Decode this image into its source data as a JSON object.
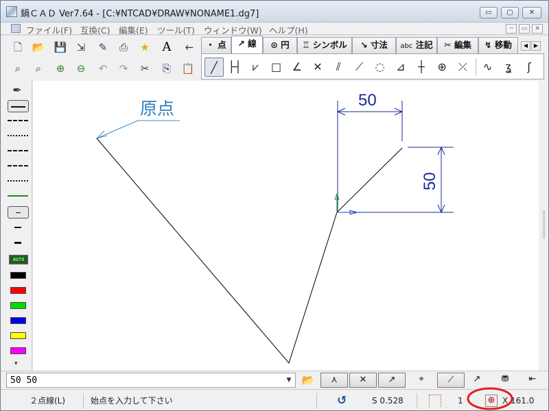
{
  "window": {
    "title": "鍋ＣＡＤ Ver7.64 - [C:¥NTCAD¥DRAW¥NONAME1.dg7]",
    "buttons": {
      "minimize": "▭",
      "maximize": "▢",
      "close": "✕"
    }
  },
  "menu": {
    "items": [
      "ファイル(F)",
      "互換(C)",
      "編集(E)",
      "ツール(T)",
      "ウィンドウ(W)",
      "ヘルプ(H)"
    ],
    "mdi_buttons": [
      "─",
      "▭",
      "✕"
    ]
  },
  "toolbar": {
    "row1": [
      {
        "icon": "new-file-icon",
        "glyph": "🗋"
      },
      {
        "icon": "open-folder-icon",
        "glyph": "📂"
      },
      {
        "icon": "save-icon",
        "glyph": "💾"
      },
      {
        "icon": "export-icon",
        "glyph": "⇲"
      },
      {
        "icon": "wizard-icon",
        "glyph": "✎"
      },
      {
        "icon": "print-icon",
        "glyph": "⎙"
      },
      {
        "icon": "star-icon",
        "glyph": "★"
      },
      {
        "icon": "text-font-icon",
        "glyph": "A"
      },
      {
        "icon": "back-arrow-icon",
        "glyph": "←"
      }
    ],
    "row2": [
      {
        "icon": "zoom-window-icon",
        "glyph": "⌕"
      },
      {
        "icon": "zoom-fit-icon",
        "glyph": "⌕"
      },
      {
        "icon": "zoom-in-icon",
        "glyph": "⊕"
      },
      {
        "icon": "zoom-out-icon",
        "glyph": "⊖"
      },
      {
        "icon": "undo-icon",
        "glyph": "↶"
      },
      {
        "icon": "redo-icon",
        "glyph": "↷"
      },
      {
        "icon": "cut-icon",
        "glyph": "✂"
      },
      {
        "icon": "copy-icon",
        "glyph": "⎘"
      },
      {
        "icon": "paste-icon",
        "glyph": "📋"
      }
    ]
  },
  "tabs": [
    {
      "glyph": "・",
      "label": "点"
    },
    {
      "glyph": "↗",
      "label": "線"
    },
    {
      "glyph": "⊙",
      "label": "円"
    },
    {
      "glyph": "♖",
      "label": "シンボル"
    },
    {
      "glyph": "↘",
      "label": "寸法"
    },
    {
      "glyph": "abc",
      "label": "注記"
    },
    {
      "glyph": "✂",
      "label": "編集"
    },
    {
      "glyph": "↯",
      "label": "移動"
    }
  ],
  "tab_arrows": [
    "◀",
    "▶"
  ],
  "commands": [
    {
      "icon": "two-point-line-icon",
      "glyph": "╱"
    },
    {
      "icon": "dimension-line-icon",
      "glyph": "├┤"
    },
    {
      "icon": "polyline-icon",
      "glyph": "⩗"
    },
    {
      "icon": "rectangle-icon",
      "glyph": "□"
    },
    {
      "icon": "angle-line-icon",
      "glyph": "∠"
    },
    {
      "icon": "cross-line-icon",
      "glyph": "✕"
    },
    {
      "icon": "parallel-line-icon",
      "glyph": "⫽"
    },
    {
      "icon": "tangent-line-icon",
      "glyph": "⟋"
    },
    {
      "icon": "circle-tangent-icon",
      "glyph": "◌"
    },
    {
      "icon": "bisector-icon",
      "glyph": "⊿"
    },
    {
      "icon": "center-cross-icon",
      "glyph": "┼"
    },
    {
      "icon": "center-mark-icon",
      "glyph": "⊕"
    },
    {
      "icon": "trim-line-icon",
      "glyph": "⤫"
    },
    {
      "icon": "curve-icon",
      "glyph": "∿"
    },
    {
      "icon": "spline-icon",
      "glyph": "ʓ"
    },
    {
      "icon": "freehand-icon",
      "glyph": "ʃ"
    }
  ],
  "palette": {
    "tool_icon": "eyedropper-icon",
    "auto_label": "AUTO",
    "colors": [
      "#000000",
      "#ff0000",
      "#00dd00",
      "#0000ee",
      "#ffff00",
      "#ff00ff"
    ],
    "scroll_glyph": "▾"
  },
  "drawing": {
    "origin_label": "原点",
    "dim_horizontal": "50",
    "dim_vertical": "50"
  },
  "input": {
    "value": "50  50",
    "dropdown_glyph": "▼",
    "folder_icon": "open-folder-icon",
    "snap_buttons": [
      {
        "icon": "snap-endpoint-icon",
        "glyph": "⋏"
      },
      {
        "icon": "snap-intersection-icon",
        "glyph": "✕"
      },
      {
        "icon": "snap-onpoint-icon",
        "glyph": "↗"
      },
      {
        "icon": "snap-center-icon",
        "glyph": "⌖"
      },
      {
        "icon": "snap-midpoint-icon",
        "glyph": "⟋"
      },
      {
        "icon": "snap-free-icon",
        "glyph": "↗"
      },
      {
        "icon": "snap-lock-icon",
        "glyph": "⛃"
      },
      {
        "icon": "snap-extra-icon",
        "glyph": "⇤"
      }
    ]
  },
  "status": {
    "mode": "２点線(L)",
    "prompt": "始点を入力して下さい",
    "refresh_glyph": "↺",
    "scale": "S 0.528",
    "layer": "1",
    "coord_x": "X 161.0",
    "accent": "#2050a0",
    "highlight": "#e02020"
  }
}
